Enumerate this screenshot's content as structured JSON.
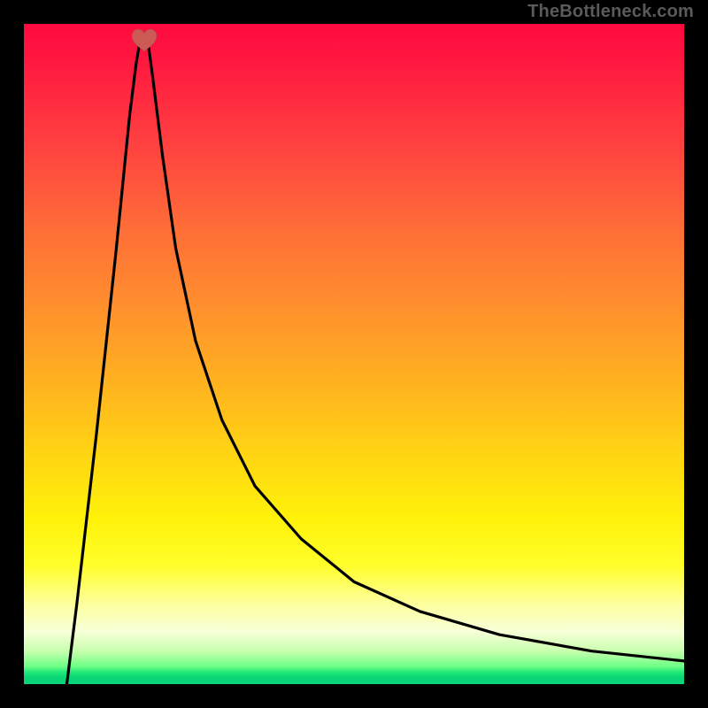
{
  "watermark": "TheBottleneck.com",
  "colors": {
    "frame": "#000000",
    "heart_fill": "#cc5a55",
    "heart_stroke": "#b34844",
    "curve_stroke": "#000000"
  },
  "heart_marker": {
    "x_pct": 18.2,
    "y_pct": 97.6
  },
  "chart_data": {
    "type": "line",
    "title": "",
    "xlabel": "",
    "ylabel": "",
    "xlim_pct": [
      0,
      100
    ],
    "ylim_pct": [
      0,
      100
    ],
    "annotations": [
      "heart marker at minimum"
    ],
    "background_gradient": [
      "#ff0a3f",
      "#ff6a38",
      "#ffd712",
      "#fdffa0",
      "#0bd37b"
    ],
    "series": [
      {
        "name": "left-branch",
        "x_pct": [
          6.5,
          8,
          9.5,
          11,
          12.5,
          14,
          15,
          16,
          17,
          17.8
        ],
        "y_pct": [
          0,
          12,
          25,
          38,
          52,
          66,
          76,
          86,
          94,
          98.7
        ]
      },
      {
        "name": "right-branch",
        "x_pct": [
          18.6,
          19.5,
          21,
          23,
          26,
          30,
          35,
          42,
          50,
          60,
          72,
          86,
          100
        ],
        "y_pct": [
          98.7,
          92,
          80,
          66,
          52,
          40,
          30,
          22,
          15.5,
          11,
          7.5,
          5,
          3.5
        ]
      }
    ]
  }
}
